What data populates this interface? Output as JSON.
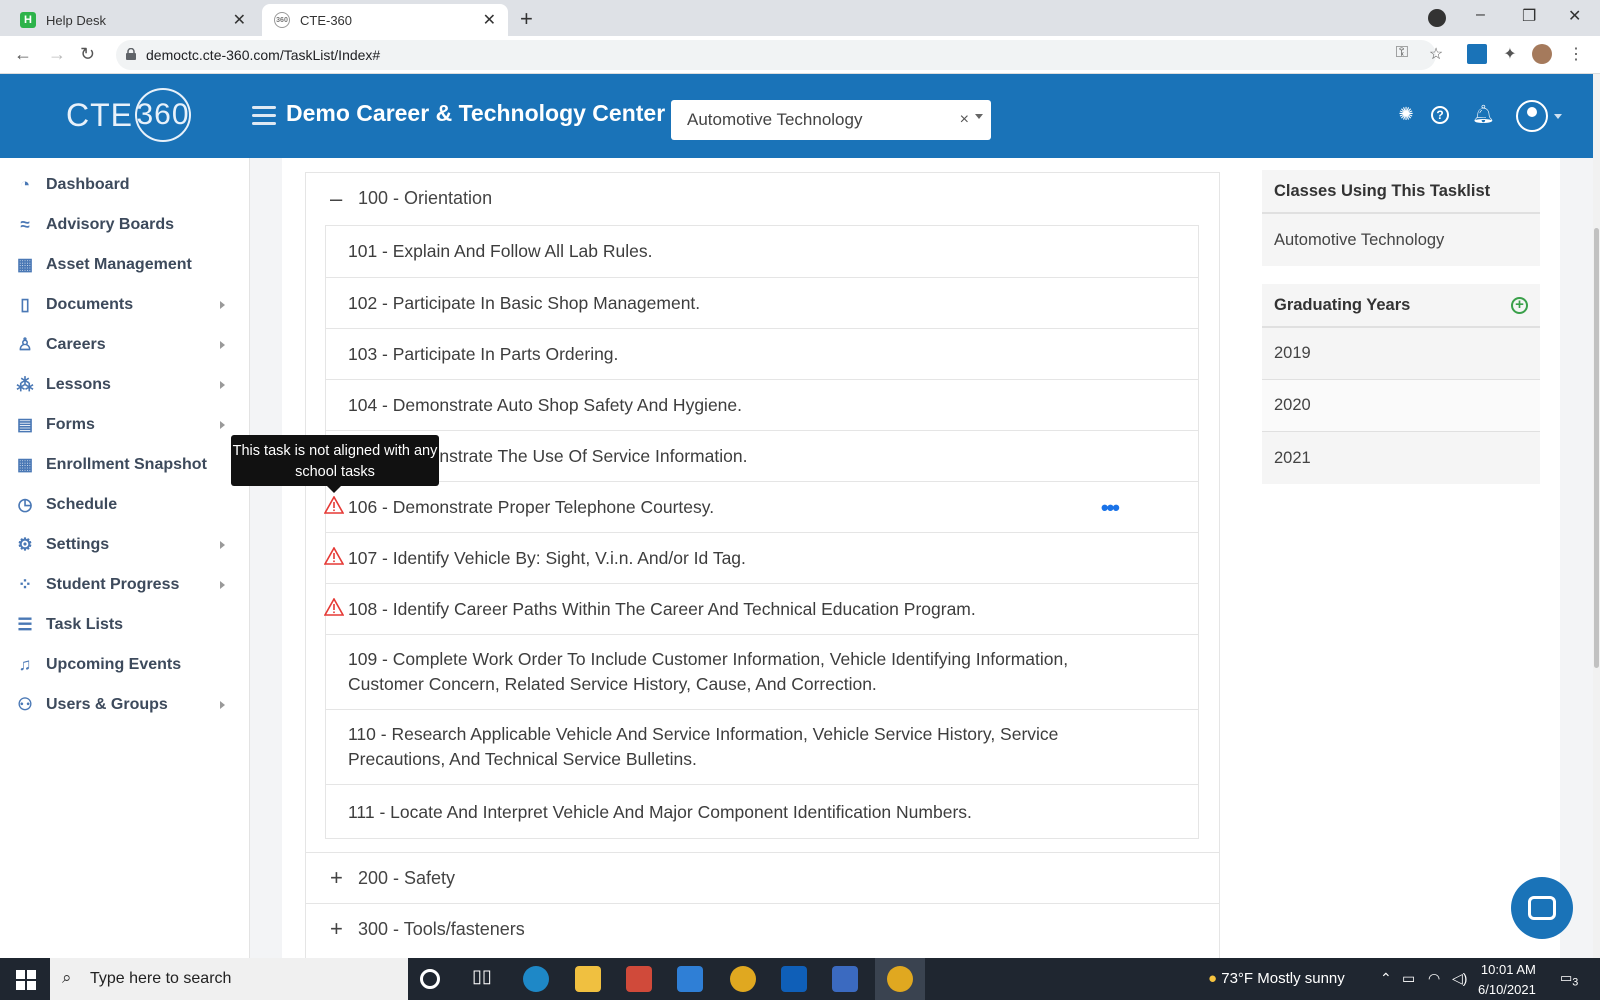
{
  "browser": {
    "tabs": [
      {
        "title": "Help Desk",
        "favicon": "H"
      },
      {
        "title": "CTE-360",
        "favicon": "360"
      }
    ],
    "url": "democtc.cte-360.com/TaskList/Index#"
  },
  "header": {
    "logo_text": "CTE",
    "logo_ring": "360",
    "org_name": "Demo Career & Technology Center",
    "class_select": {
      "value": "Automotive Technology",
      "clear": "×"
    }
  },
  "sidebar": {
    "items": [
      {
        "label": "Dashboard",
        "icon": "gauge-icon",
        "glyph": "◔",
        "has_submenu": false
      },
      {
        "label": "Advisory Boards",
        "icon": "handshake-icon",
        "glyph": "≈",
        "has_submenu": false
      },
      {
        "label": "Asset Management",
        "icon": "warehouse-icon",
        "glyph": "▦",
        "has_submenu": false
      },
      {
        "label": "Documents",
        "icon": "file-icon",
        "glyph": "▯",
        "has_submenu": true
      },
      {
        "label": "Careers",
        "icon": "user-tie-icon",
        "glyph": "♙",
        "has_submenu": true
      },
      {
        "label": "Lessons",
        "icon": "users-grid-icon",
        "glyph": "⁂",
        "has_submenu": true
      },
      {
        "label": "Forms",
        "icon": "clipboard-icon",
        "glyph": "▤",
        "has_submenu": true
      },
      {
        "label": "Enrollment Snapshot",
        "icon": "table-icon",
        "glyph": "▦",
        "has_submenu": false
      },
      {
        "label": "Schedule",
        "icon": "clock-icon",
        "glyph": "◷",
        "has_submenu": false
      },
      {
        "label": "Settings",
        "icon": "gears-icon",
        "glyph": "⚙",
        "has_submenu": true
      },
      {
        "label": "Student Progress",
        "icon": "spinner-icon",
        "glyph": "⁘",
        "has_submenu": true
      },
      {
        "label": "Task Lists",
        "icon": "list-icon",
        "glyph": "☰",
        "has_submenu": false
      },
      {
        "label": "Upcoming Events",
        "icon": "bell-icon",
        "glyph": "♫",
        "has_submenu": false
      },
      {
        "label": "Users & Groups",
        "icon": "users-icon",
        "glyph": "⚇",
        "has_submenu": true
      }
    ]
  },
  "main": {
    "groups": [
      {
        "label": "100 - Orientation",
        "sign": "–",
        "expanded": true
      },
      {
        "label": "200 - Safety",
        "sign": "+",
        "expanded": false
      },
      {
        "label": "300 - Tools/fasteners",
        "sign": "+",
        "expanded": false
      }
    ],
    "tasks": [
      {
        "text": "101 - Explain And Follow All Lab Rules.",
        "warning": false
      },
      {
        "text": "102 - Participate In Basic Shop Management.",
        "warning": false
      },
      {
        "text": "103 - Participate In Parts Ordering.",
        "warning": false
      },
      {
        "text": "104 - Demonstrate Auto Shop Safety And Hygiene.",
        "warning": false
      },
      {
        "text": "105 - Demonstrate The Use Of Service Information.",
        "warning": false
      },
      {
        "text": "106 - Demonstrate Proper Telephone Courtesy.",
        "warning": true
      },
      {
        "text": "107 - Identify Vehicle By: Sight, V.i.n. And/or Id Tag.",
        "warning": true
      },
      {
        "text": "108 - Identify Career Paths Within The Career And Technical Education Program.",
        "warning": true
      },
      {
        "text": "109 - Complete Work Order To Include Customer Information, Vehicle Identifying Information, Customer Concern, Related Service History, Cause, And Correction.",
        "warning": false
      },
      {
        "text": "110 - Research Applicable Vehicle And Service Information, Vehicle Service History, Service Precautions, And Technical Service Bulletins.",
        "warning": false
      },
      {
        "text": "111 - Locate And Interpret Vehicle And Major Component Identification Numbers.",
        "warning": false
      }
    ],
    "tooltip": "This task is not aligned with any school tasks",
    "more_menu": "•••"
  },
  "right": {
    "classes": {
      "title": "Classes Using This Tasklist",
      "items": [
        "Automotive Technology"
      ]
    },
    "years": {
      "title": "Graduating Years",
      "add": "+",
      "items": [
        "2019",
        "2020",
        "2021"
      ]
    }
  },
  "taskbar": {
    "search_placeholder": "Type here to search",
    "weather": "73°F  Mostly sunny",
    "time": "10:01 AM",
    "date": "6/10/2021",
    "notifications": "3"
  },
  "colors": {
    "brand": "#1a73b8",
    "warning": "#e53935",
    "add": "#3aa04a"
  }
}
